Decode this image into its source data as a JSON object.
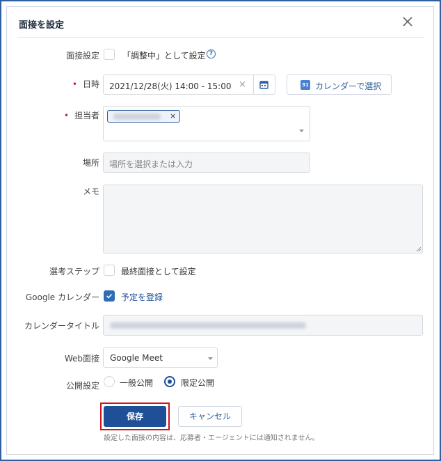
{
  "dialog": {
    "title": "面接を設定",
    "close_icon": "close-icon"
  },
  "form": {
    "interview_setting": {
      "label": "面接設定",
      "checkbox_label": "「調整中」として設定",
      "checked": false,
      "help_icon": "question-circle-icon",
      "help_glyph": "?"
    },
    "datetime": {
      "required_mark": "•",
      "label": "日時",
      "value": "2021/12/28(火) 14:00 - 15:00",
      "clear_glyph": "×",
      "calendar_icon": "calendar-icon",
      "calendar_button_label": "カレンダーで選択",
      "calendar_button_badge": "31"
    },
    "assignee": {
      "required_mark": "•",
      "label": "担当者",
      "tag_remove_glyph": "×",
      "dropdown_icon": "caret-down-icon"
    },
    "place": {
      "label": "場所",
      "placeholder": "場所を選択または入力"
    },
    "memo": {
      "label": "メモ",
      "value": ""
    },
    "selection_step": {
      "label": "選考ステップ",
      "checkbox_label": "最終面接として設定",
      "checked": false
    },
    "google_calendar": {
      "label": "Google カレンダー",
      "checkbox_label": "予定を登録",
      "checked": true
    },
    "calendar_title": {
      "label": "カレンダータイトル"
    },
    "web_interview": {
      "label": "Web面接",
      "selected": "Google Meet",
      "dropdown_icon": "caret-down-icon"
    },
    "visibility": {
      "label": "公開設定",
      "options": [
        "一般公開",
        "限定公開"
      ],
      "selected": "限定公開"
    }
  },
  "actions": {
    "save_label": "保存",
    "cancel_label": "キャンセル",
    "note": "設定した面接の内容は、応募者・エージェントには通知されません。"
  },
  "colors": {
    "primary": "#1f4f96",
    "accent": "#2f6db5",
    "required": "#c0272d",
    "highlight_border": "#d0101a",
    "frame": "#2f5f9e"
  }
}
